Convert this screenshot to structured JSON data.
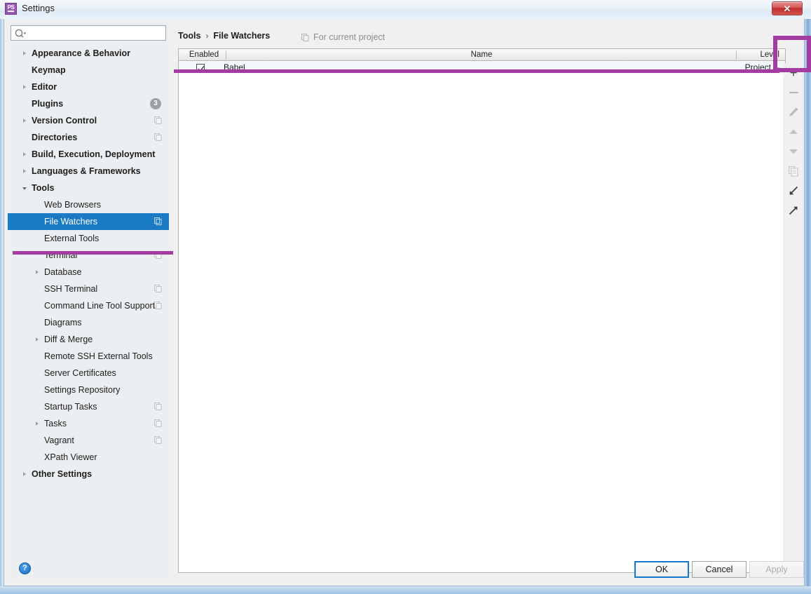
{
  "window": {
    "title": "Settings",
    "app_icon": "phpstorm-logo-icon",
    "app_icon_text": "PS",
    "close_label": "✕"
  },
  "search": {
    "value": "",
    "placeholder": "",
    "icon": "search-icon"
  },
  "sidebar": {
    "items": [
      {
        "label": "Appearance & Behavior",
        "level": 0,
        "arrow": "right",
        "badge": null,
        "copy_icon": false,
        "selected": false
      },
      {
        "label": "Keymap",
        "level": 0,
        "arrow": null,
        "badge": null,
        "copy_icon": false,
        "selected": false
      },
      {
        "label": "Editor",
        "level": 0,
        "arrow": "right",
        "badge": null,
        "copy_icon": false,
        "selected": false
      },
      {
        "label": "Plugins",
        "level": 0,
        "arrow": null,
        "badge": "3",
        "copy_icon": false,
        "selected": false
      },
      {
        "label": "Version Control",
        "level": 0,
        "arrow": "right",
        "badge": null,
        "copy_icon": true,
        "selected": false
      },
      {
        "label": "Directories",
        "level": 0,
        "arrow": null,
        "badge": null,
        "copy_icon": true,
        "selected": false
      },
      {
        "label": "Build, Execution, Deployment",
        "level": 0,
        "arrow": "right",
        "badge": null,
        "copy_icon": false,
        "selected": false
      },
      {
        "label": "Languages & Frameworks",
        "level": 0,
        "arrow": "right",
        "badge": null,
        "copy_icon": false,
        "selected": false
      },
      {
        "label": "Tools",
        "level": 0,
        "arrow": "down",
        "badge": null,
        "copy_icon": false,
        "selected": false
      },
      {
        "label": "Web Browsers",
        "level": 1,
        "arrow": null,
        "badge": null,
        "copy_icon": false,
        "selected": false
      },
      {
        "label": "File Watchers",
        "level": 1,
        "arrow": null,
        "badge": null,
        "copy_icon": true,
        "selected": true
      },
      {
        "label": "External Tools",
        "level": 1,
        "arrow": null,
        "badge": null,
        "copy_icon": false,
        "selected": false
      },
      {
        "label": "Terminal",
        "level": 1,
        "arrow": null,
        "badge": null,
        "copy_icon": true,
        "selected": false
      },
      {
        "label": "Database",
        "level": 1,
        "arrow": "right",
        "badge": null,
        "copy_icon": false,
        "selected": false
      },
      {
        "label": "SSH Terminal",
        "level": 1,
        "arrow": null,
        "badge": null,
        "copy_icon": true,
        "selected": false
      },
      {
        "label": "Command Line Tool Support",
        "level": 1,
        "arrow": null,
        "badge": null,
        "copy_icon": true,
        "selected": false
      },
      {
        "label": "Diagrams",
        "level": 1,
        "arrow": null,
        "badge": null,
        "copy_icon": false,
        "selected": false
      },
      {
        "label": "Diff & Merge",
        "level": 1,
        "arrow": "right",
        "badge": null,
        "copy_icon": false,
        "selected": false
      },
      {
        "label": "Remote SSH External Tools",
        "level": 1,
        "arrow": null,
        "badge": null,
        "copy_icon": false,
        "selected": false
      },
      {
        "label": "Server Certificates",
        "level": 1,
        "arrow": null,
        "badge": null,
        "copy_icon": false,
        "selected": false
      },
      {
        "label": "Settings Repository",
        "level": 1,
        "arrow": null,
        "badge": null,
        "copy_icon": false,
        "selected": false
      },
      {
        "label": "Startup Tasks",
        "level": 1,
        "arrow": null,
        "badge": null,
        "copy_icon": true,
        "selected": false
      },
      {
        "label": "Tasks",
        "level": 1,
        "arrow": "right",
        "badge": null,
        "copy_icon": true,
        "selected": false
      },
      {
        "label": "Vagrant",
        "level": 1,
        "arrow": null,
        "badge": null,
        "copy_icon": true,
        "selected": false
      },
      {
        "label": "XPath Viewer",
        "level": 1,
        "arrow": null,
        "badge": null,
        "copy_icon": false,
        "selected": false
      },
      {
        "label": "Other Settings",
        "level": 0,
        "arrow": "right",
        "badge": null,
        "copy_icon": false,
        "selected": false
      }
    ]
  },
  "main": {
    "breadcrumb": {
      "root": "Tools",
      "separator": "›",
      "current": "File Watchers"
    },
    "scope_label": "For current project",
    "scope_icon": "copy-scope-icon",
    "table": {
      "columns": [
        "Enabled",
        "Name",
        "Level"
      ],
      "rows": [
        {
          "enabled": true,
          "name": "Babel",
          "level": "Project"
        }
      ]
    },
    "toolbar": [
      {
        "name": "add-button",
        "icon": "plus-icon",
        "label": "+",
        "enabled": true
      },
      {
        "name": "remove-button",
        "icon": "minus-icon",
        "label": "−",
        "enabled": false
      },
      {
        "name": "edit-button",
        "icon": "pencil-icon",
        "label": "",
        "enabled": false
      },
      {
        "name": "move-up-button",
        "icon": "arrow-up-icon",
        "label": "",
        "enabled": false
      },
      {
        "name": "move-down-button",
        "icon": "arrow-down-icon",
        "label": "",
        "enabled": false
      },
      {
        "name": "copy-button",
        "icon": "copy-icon",
        "label": "",
        "enabled": false
      },
      {
        "name": "import-button",
        "icon": "import-arrow-icon",
        "label": "",
        "enabled": true
      },
      {
        "name": "export-button",
        "icon": "export-arrow-icon",
        "label": "",
        "enabled": true
      }
    ]
  },
  "footer": {
    "help_icon": "help-icon",
    "help_label": "?",
    "ok_label": "OK",
    "cancel_label": "Cancel",
    "apply_label": "Apply"
  },
  "annotations": {
    "highlight_color": "#a33ba3",
    "selection_color": "#1a7bc4"
  }
}
